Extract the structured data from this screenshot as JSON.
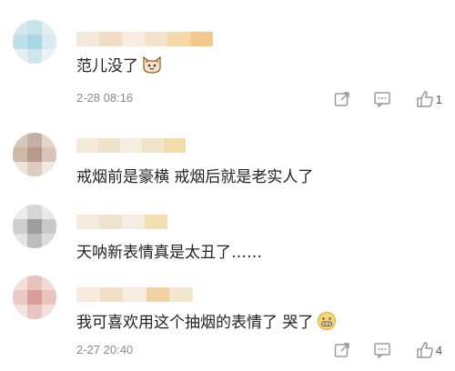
{
  "comments": [
    {
      "text": "范儿没了",
      "emoji": "cat-face-emoji",
      "date": "2-28 08:16",
      "likes": "1"
    },
    {
      "text": "戒烟前是豪横 戒烟后就是老实人了"
    },
    {
      "text": "天呐新表情真是太丑了……"
    },
    {
      "text": "我可喜欢用这个抽烟的表情了 哭了",
      "emoji": "grimacing-face-emoji",
      "date": "2-27 20:40",
      "likes": "4"
    }
  ],
  "icons": {
    "share": "share-icon",
    "comment": "comment-icon",
    "like": "thumbs-up-icon"
  },
  "colors": {
    "text": "#222222",
    "meta": "#8a8a8a",
    "icon": "#9a9a9a"
  }
}
